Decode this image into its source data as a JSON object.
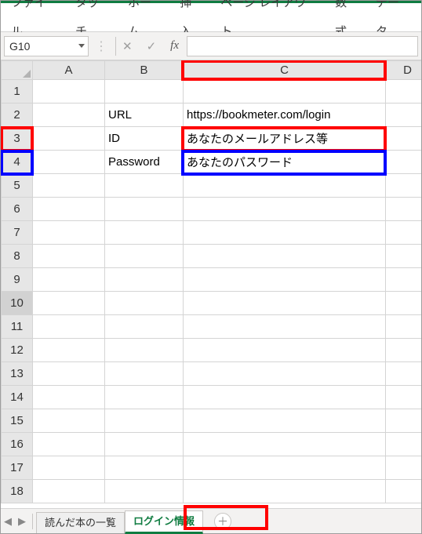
{
  "ribbon": {
    "tabs": [
      "ファイル",
      "タッチ",
      "ホーム",
      "挿入",
      "ページ レイアウト",
      "数式",
      "データ"
    ]
  },
  "namebox": {
    "value": "G10"
  },
  "formula_icons": {
    "cancel": "✕",
    "enter": "✓",
    "fx": "fx"
  },
  "columns": [
    "A",
    "B",
    "C",
    "D"
  ],
  "rows": [
    "1",
    "2",
    "3",
    "4",
    "5",
    "6",
    "7",
    "8",
    "9",
    "10",
    "11",
    "12",
    "13",
    "14",
    "15",
    "16",
    "17",
    "18"
  ],
  "selected_row": "10",
  "cells": {
    "B2": "URL",
    "C2": "https://bookmeter.com/login",
    "B3": "ID",
    "C3": "あなたのメールアドレス等",
    "B4": "Password",
    "C4": "あなたのパスワード"
  },
  "sheet_tabs": {
    "nav_prev": "◀",
    "nav_next": "▶",
    "tabs": [
      "読んだ本の一覧",
      "ログイン情報"
    ],
    "active": "ログイン情報",
    "add": "＋"
  },
  "chart_data": {
    "type": "table",
    "headers": [
      "",
      "B",
      "C"
    ],
    "rows": [
      {
        "row": 2,
        "B": "URL",
        "C": "https://bookmeter.com/login"
      },
      {
        "row": 3,
        "B": "ID",
        "C": "あなたのメールアドレス等"
      },
      {
        "row": 4,
        "B": "Password",
        "C": "あなたのパスワード"
      }
    ]
  }
}
